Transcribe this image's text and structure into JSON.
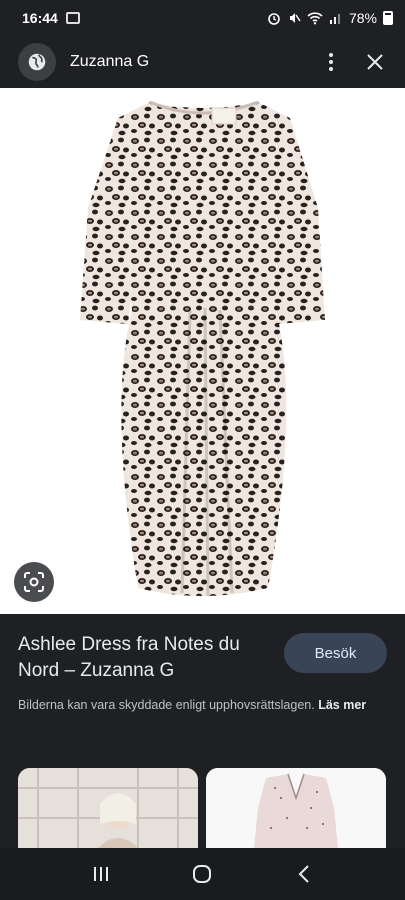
{
  "status": {
    "time": "16:44",
    "battery": "78%"
  },
  "header": {
    "title": "Zuzanna G"
  },
  "result": {
    "headline": "Ashlee Dress fra Notes du Nord – Zuzanna G",
    "visit_label": "Besök",
    "copyright": "Bilderna kan vara skyddade enligt upphovsrättslagen.",
    "more_label": "Läs mer"
  },
  "colors": {
    "background": "#1f2023",
    "visit_button": "#394457",
    "text": "#e8eaed"
  },
  "icons": [
    "globe-icon",
    "more-vert-icon",
    "close-icon",
    "lens-icon",
    "recents-icon",
    "home-icon",
    "back-icon"
  ]
}
